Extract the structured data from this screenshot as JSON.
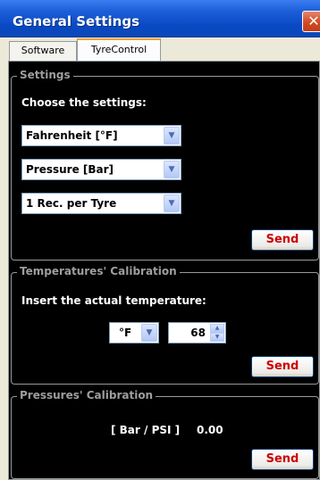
{
  "window": {
    "title": "General Settings",
    "close_glyph": "✕"
  },
  "tabs": [
    {
      "label": "Software",
      "active": false
    },
    {
      "label": "TyreControl",
      "active": true
    }
  ],
  "settings_group": {
    "legend": "Settings",
    "prompt": "Choose the settings:",
    "selects": [
      {
        "value": "Fahrenheit  [°F]"
      },
      {
        "value": "Pressure  [Bar]"
      },
      {
        "value": "1 Rec. per Tyre"
      }
    ],
    "send_label": "Send"
  },
  "temperature_group": {
    "legend": "Temperatures' Calibration",
    "prompt": "Insert the actual temperature:",
    "unit_value": "°F",
    "temperature_value": "68",
    "send_label": "Send"
  },
  "pressure_group": {
    "legend": "Pressures' Calibration",
    "unit_label": "[ Bar / PSI ]",
    "value": "0.00",
    "send_label": "Send"
  },
  "icons": {
    "dropdown": "chevron-down-icon",
    "spinner_up": "spinner-up-icon",
    "spinner_down": "spinner-down-icon",
    "close": "close-icon"
  },
  "colors": {
    "accent_send_text": "#cc0000",
    "panel_background": "#000000",
    "titlebar": "#0a49c4"
  }
}
